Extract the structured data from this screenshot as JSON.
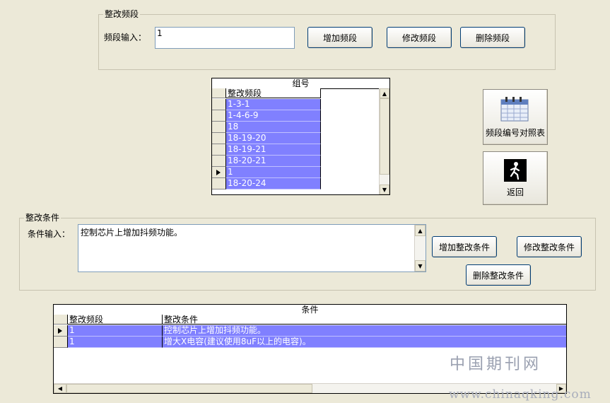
{
  "segment_group": {
    "legend": "整改频段",
    "input_label": "频段输入：",
    "input_value": "1",
    "add_button": "增加频段",
    "modify_button": "修改频段",
    "delete_button": "删除频段"
  },
  "group_grid": {
    "caption": "组号",
    "column": "整改频段",
    "rows": [
      "1-3-1",
      "1-4-6-9",
      "18",
      "18-19-20",
      "18-19-21",
      "18-20-21",
      "1",
      "18-20-24"
    ],
    "current_row": 6
  },
  "side_buttons": {
    "lookup": "频段编号对照表",
    "back": "返回"
  },
  "condition_group": {
    "legend": "整改条件",
    "input_label": "条件输入：",
    "input_value": "控制芯片上增加抖频功能。",
    "add_button": "增加整改条件",
    "modify_button": "修改整改条件",
    "delete_button": "删除整改条件"
  },
  "condition_grid": {
    "caption": "条件",
    "columns": [
      "整改频段",
      "整改条件"
    ],
    "rows": [
      {
        "segment": "1",
        "condition": "控制芯片上增加抖频功能。"
      },
      {
        "segment": "1",
        "condition": "增大X电容(建议使用8uF以上的电容)。"
      }
    ],
    "current_row": 0
  },
  "watermark": {
    "cn": "中国期刊网",
    "url": "www.chinaqking.com"
  },
  "colors": {
    "background": "#ece9d8",
    "row_highlight": "#8080ff",
    "button_border": "#003c74"
  }
}
